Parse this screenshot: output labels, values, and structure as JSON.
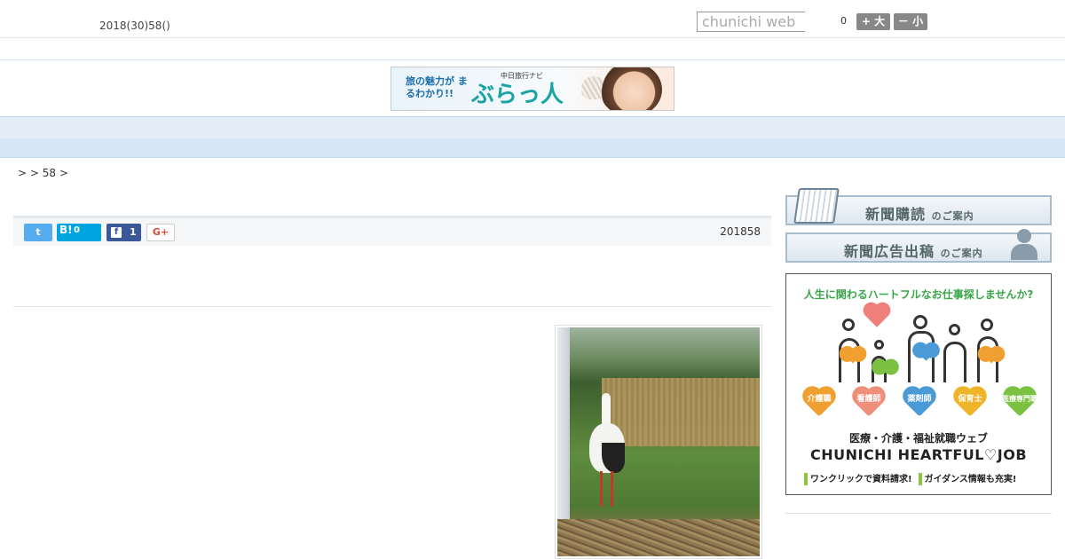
{
  "header": {
    "date": "2018(30)58()",
    "search_placeholder": "chunichi web",
    "counter": "0",
    "font_large": "+ 大",
    "font_small": "－ 小"
  },
  "banner": {
    "tagline": "旅の魅力が まるわかり!!",
    "sub": "中日旅行ナビ",
    "brand": "ぶらっ人"
  },
  "nav": {
    "items": [
      "",
      "",
      "",
      "",
      "",
      "",
      "",
      "",
      ""
    ]
  },
  "breadcrumb": ">  > 58 >",
  "share": {
    "twitter_label": "t",
    "hatena_logo": "B!",
    "hatena_count": "0",
    "facebook_logo": "f",
    "facebook_count": "1",
    "gplus_label": "G+"
  },
  "article": {
    "date": "201858"
  },
  "sidebar": {
    "subscribe_label": "新聞購読",
    "subscribe_suffix": "のご案内",
    "ad_label": "新聞広告出稿",
    "ad_suffix": "のご案内",
    "job_ad": {
      "headline": "人生に関わるハートフルなお仕事探しませんか?",
      "categories": [
        "介護職",
        "看護師",
        "薬剤師",
        "保育士",
        "医療専門職"
      ],
      "category_colors": [
        "#f0a030",
        "#ef8f7a",
        "#4a9ad8",
        "#f0b428",
        "#7cc242"
      ],
      "title_jp": "医療・介護・福祉就職ウェブ",
      "title_en": "CHUNICHI HEARTFUL♡JOB",
      "footer_1": "ワンクリックで資料請求!",
      "footer_2": "ガイダンス情報も充実!"
    }
  }
}
